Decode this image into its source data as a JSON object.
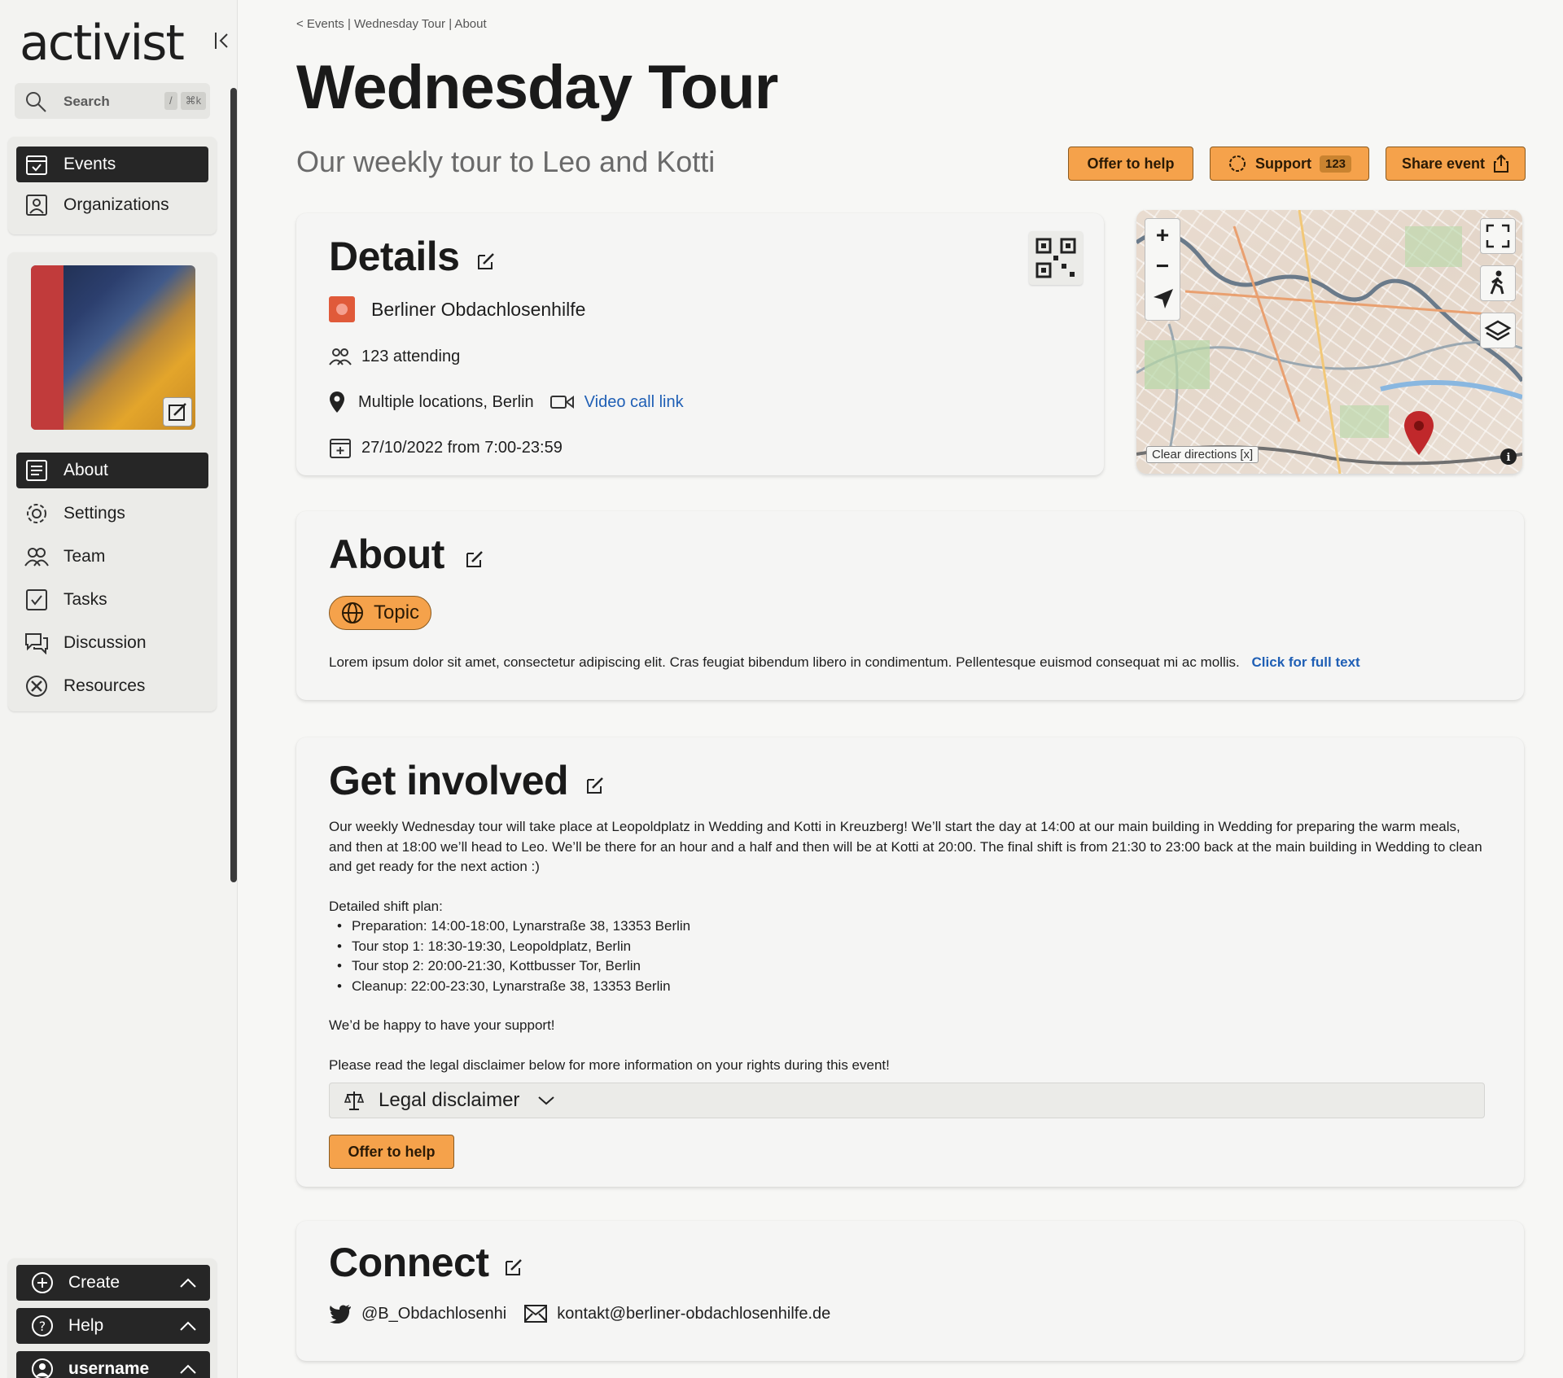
{
  "app": {
    "name": "activist"
  },
  "sidebar": {
    "search": {
      "label": "Search",
      "shortcut_slash": "/",
      "shortcut_cmd": "⌘k"
    },
    "main_nav": [
      {
        "label": "Events",
        "active": true
      },
      {
        "label": "Organizations",
        "active": false
      }
    ],
    "event_nav": [
      {
        "label": "About",
        "active": true
      },
      {
        "label": "Settings",
        "active": false
      },
      {
        "label": "Team",
        "active": false
      },
      {
        "label": "Tasks",
        "active": false
      },
      {
        "label": "Discussion",
        "active": false
      },
      {
        "label": "Resources",
        "active": false
      }
    ],
    "bottom": {
      "create": "Create",
      "help": "Help",
      "user": "username"
    }
  },
  "header": {
    "breadcrumb": "< Events | Wednesday Tour | About",
    "title": "Wednesday Tour",
    "tagline": "Our weekly tour to Leo and Kotti",
    "actions": {
      "offer_help": "Offer to help",
      "support": "Support",
      "support_count": "123",
      "share": "Share event"
    }
  },
  "details": {
    "title": "Details",
    "organization": "Berliner Obdachlosenhilfe",
    "attending": "123 attending",
    "location": "Multiple locations, Berlin",
    "video_link": "Video call link",
    "datetime": "27/10/2022 from 7:00-23:59"
  },
  "map": {
    "clear_directions": "Clear directions [x]",
    "zoom_in": "+",
    "zoom_out": "−"
  },
  "about": {
    "title": "About",
    "topic": "Topic",
    "text": "Lorem ipsum dolor sit amet, consectetur adipiscing elit. Cras feugiat bibendum libero in condimentum. Pellentesque euismod consequat mi ac mollis.",
    "full_text_link": "Click for full text"
  },
  "get_involved": {
    "title": "Get involved",
    "intro": "Our weekly Wednesday tour will take place at Leopoldplatz in Wedding and Kotti in Kreuzberg! We’ll start the day at 14:00 at our main building in Wedding for preparing the warm meals, and then at 18:00 we’ll head to Leo. We’ll be there for an hour and a half and then will be at Kotti at 20:00. The final shift is from 21:30 to 23:00 back at the main building in Wedding to clean and get ready for the next action :)",
    "shift_heading": "Detailed shift plan:",
    "shifts": [
      "Preparation: 14:00-18:00, Lynarstraße 38, 13353 Berlin",
      "Tour stop 1: 18:30-19:30, Leopoldplatz, Berlin",
      "Tour stop 2: 20:00-21:30, Kottbusser Tor, Berlin",
      "Cleanup: 22:00-23:30, Lynarstraße 38, 13353 Berlin"
    ],
    "support_line": "We’d be happy to have your support!",
    "legal_line": "Please read the legal disclaimer below for more information on your rights during this event!",
    "disclaimer_label": "Legal disclaimer",
    "offer_help": "Offer to help"
  },
  "connect": {
    "title": "Connect",
    "twitter": "@B_Obdachlosenhi",
    "email": "kontakt@berliner-obdachlosenhilfe.de"
  },
  "colors": {
    "accent": "#f5a24b",
    "dark": "#262626",
    "link": "#1f5fb5",
    "pin": "#c0282b"
  }
}
